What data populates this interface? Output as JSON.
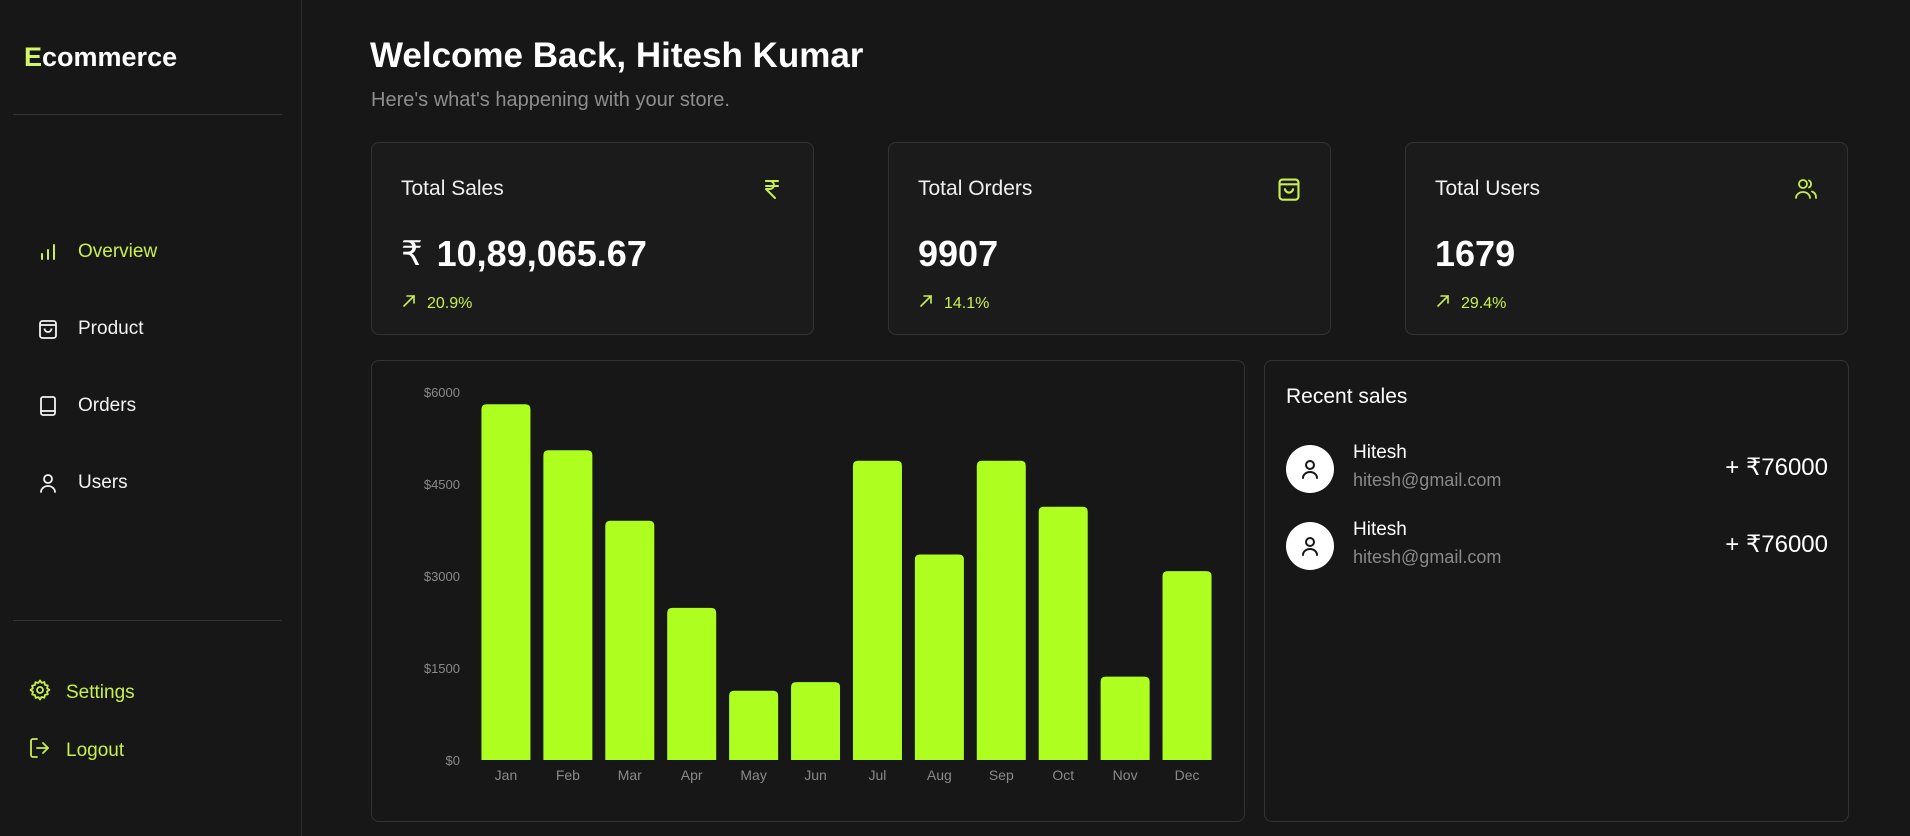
{
  "app": {
    "logo_first": "E",
    "logo_rest": "commerce"
  },
  "sidebar": {
    "items": [
      {
        "label": "Overview",
        "icon": "bar-chart-icon",
        "active": true
      },
      {
        "label": "Product",
        "icon": "shopping-bag-icon",
        "active": false
      },
      {
        "label": "Orders",
        "icon": "book-icon",
        "active": false
      },
      {
        "label": "Users",
        "icon": "user-icon",
        "active": false
      }
    ],
    "footer": [
      {
        "label": "Settings",
        "icon": "gear-icon"
      },
      {
        "label": "Logout",
        "icon": "logout-icon"
      }
    ]
  },
  "header": {
    "title": "Welcome Back, Hitesh Kumar",
    "subtitle": "Here's what's happening with your store."
  },
  "stats": [
    {
      "title": "Total Sales",
      "icon": "rupee-icon",
      "currency": "₹",
      "value": "10,89,065.67",
      "change": "20.9%"
    },
    {
      "title": "Total Orders",
      "icon": "shopping-bag-icon",
      "currency": "",
      "value": "9907",
      "change": "14.1%"
    },
    {
      "title": "Total Users",
      "icon": "users-icon",
      "currency": "",
      "value": "1679",
      "change": "29.4%"
    }
  ],
  "chart_data": {
    "type": "bar",
    "categories": [
      "Jan",
      "Feb",
      "Mar",
      "Apr",
      "May",
      "Jun",
      "Jul",
      "Aug",
      "Sep",
      "Oct",
      "Nov",
      "Dec"
    ],
    "values": [
      5800,
      5050,
      3900,
      2480,
      1130,
      1270,
      4880,
      3350,
      4880,
      4130,
      1360,
      3080
    ],
    "yticks": [
      "$0",
      "$1500",
      "$3000",
      "$4500",
      "$6000"
    ],
    "ylim": [
      0,
      6000
    ],
    "title": "",
    "xlabel": "",
    "ylabel": "",
    "bar_color": "#aeff1f",
    "grid": false
  },
  "recent_sales": {
    "title": "Recent sales",
    "items": [
      {
        "name": "Hitesh",
        "email": "hitesh@gmail.com",
        "amount": "+ ₹76000"
      },
      {
        "name": "Hitesh",
        "email": "hitesh@gmail.com",
        "amount": "+ ₹76000"
      }
    ]
  },
  "colors": {
    "accent": "#c9f04a",
    "bar": "#aeff1f",
    "background": "#171717"
  }
}
